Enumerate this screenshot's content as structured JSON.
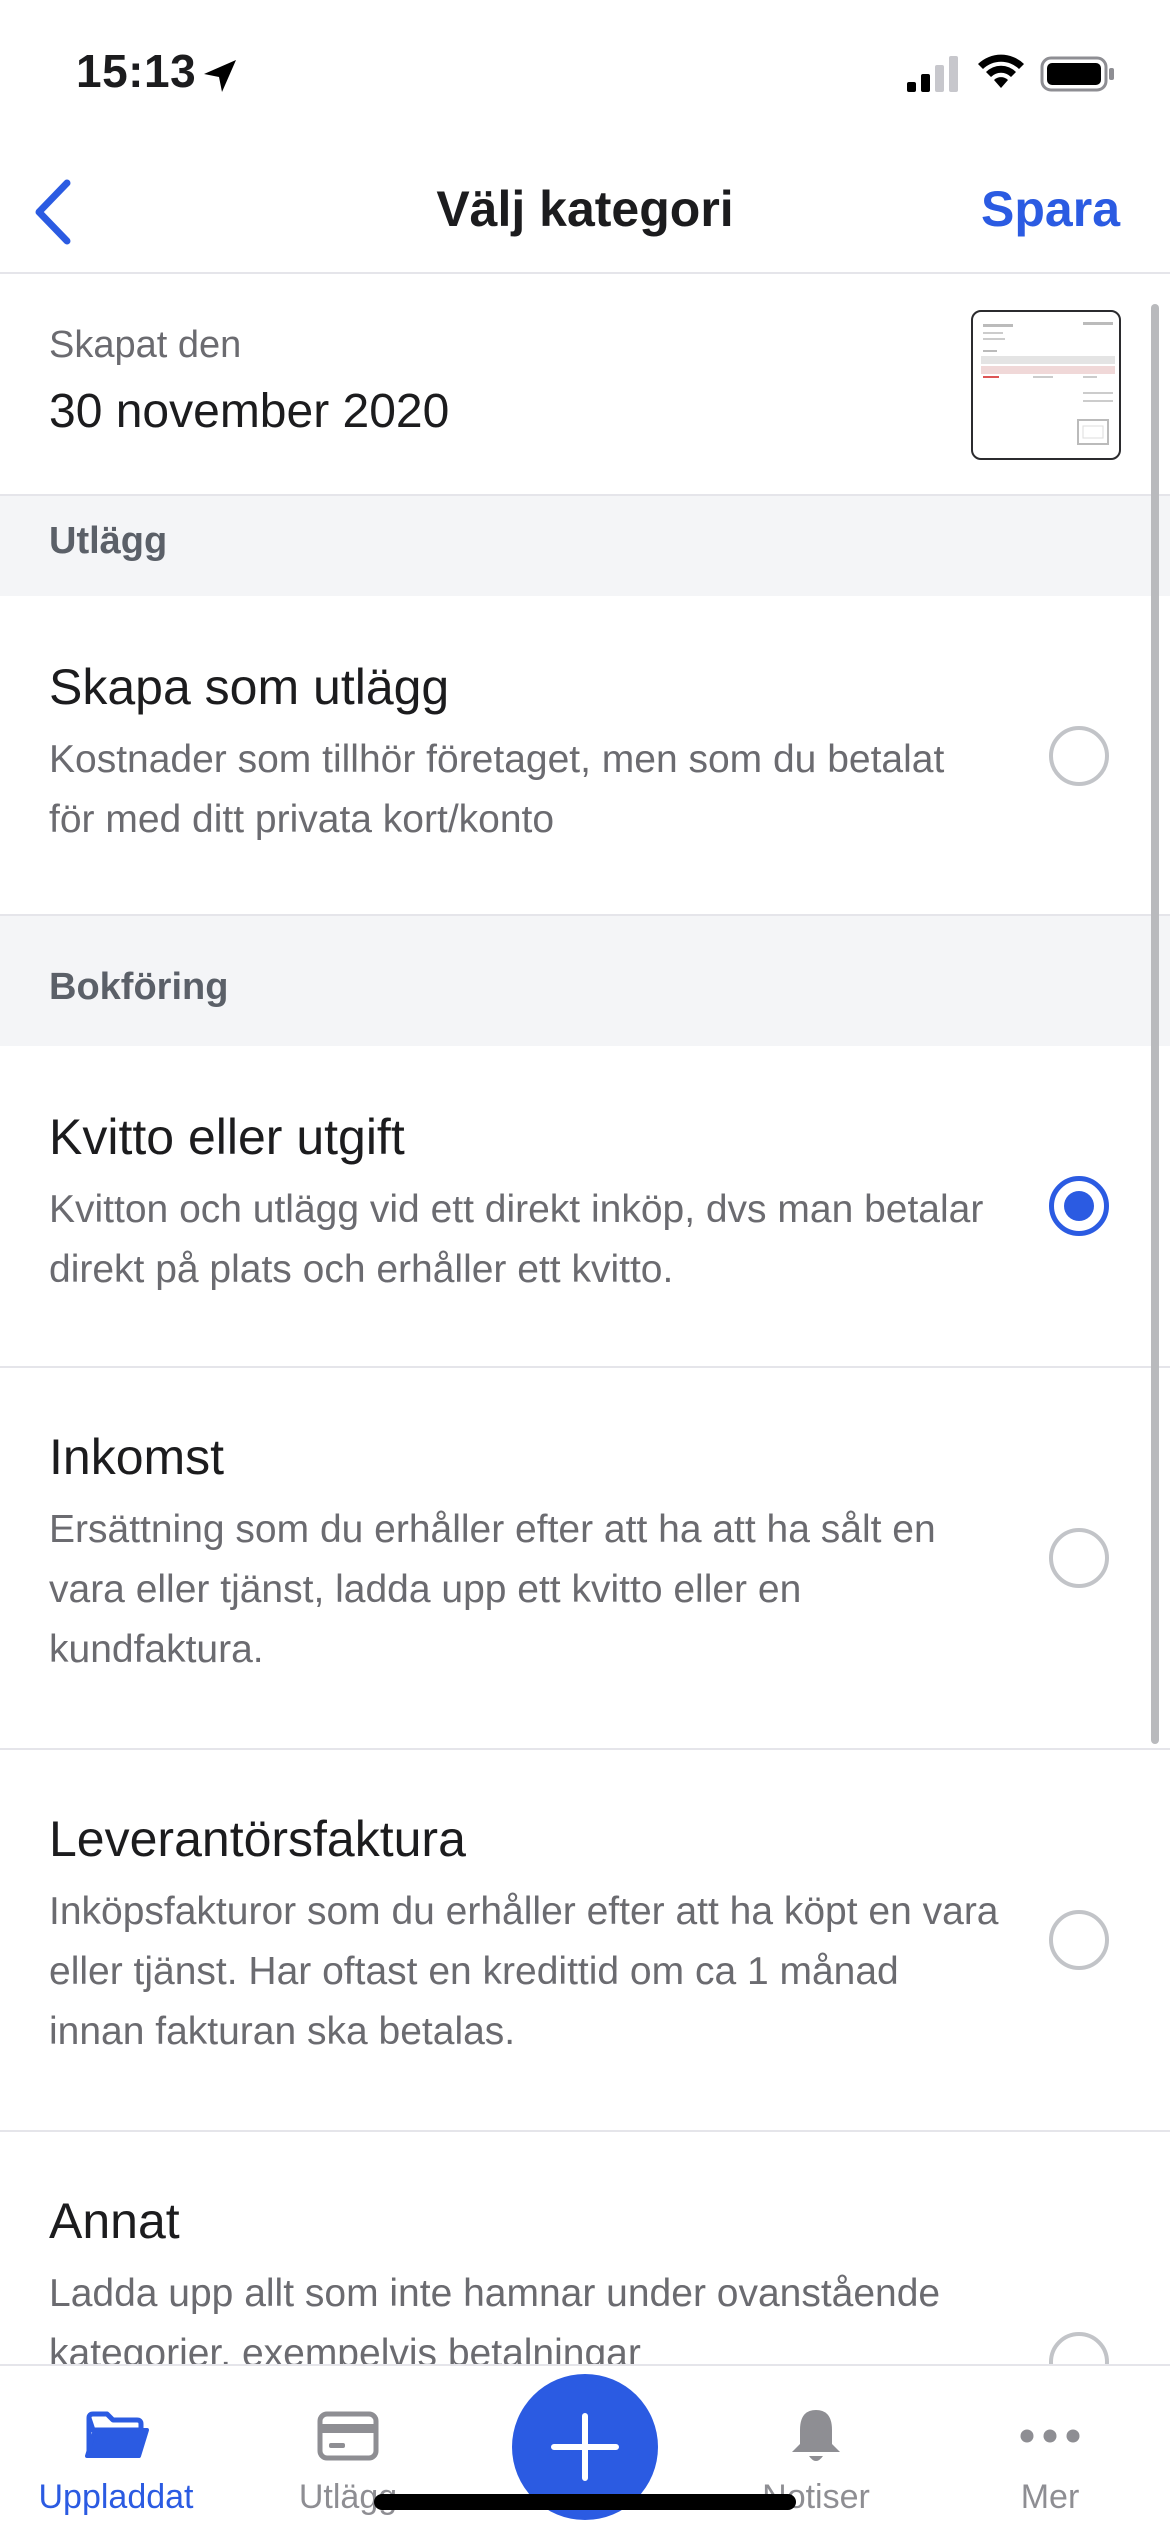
{
  "status_bar": {
    "time": "15:13"
  },
  "nav": {
    "back_icon": "chevron-left-icon",
    "title": "Välj kategori",
    "save_label": "Spara"
  },
  "created": {
    "label": "Skapat den",
    "date": "30 november 2020"
  },
  "sections": {
    "expenses": {
      "header": "Utlägg"
    },
    "bookkeeping": {
      "header": "Bokföring"
    }
  },
  "options": [
    {
      "title": "Skapa som utlägg",
      "description": "Kostnader som tillhör företaget, men som du betalat för med ditt privata kort/konto",
      "selected": false
    },
    {
      "title": "Kvitto eller utgift",
      "description": "Kvitton och utlägg vid ett direkt inköp, dvs man betalar direkt på plats och erhåller ett kvitto.",
      "selected": true
    },
    {
      "title": "Inkomst",
      "description": "Ersättning som du erhåller efter att ha att ha sålt en vara eller tjänst, ladda upp ett kvitto eller en kundfaktura.",
      "selected": false
    },
    {
      "title": "Leverantörsfaktura",
      "description": "Inköpsfakturor som du erhåller efter att ha köpt en vara eller tjänst. Har oftast en kredittid om ca 1 månad innan fakturan ska betalas.",
      "selected": false
    },
    {
      "title": "Annat",
      "description": "Ladda upp allt som inte hamnar under ovanstående kategorier, exempelvis betalningar",
      "selected": false
    }
  ],
  "tabs": [
    {
      "label": "Uppladdat",
      "icon": "folder-icon",
      "active": true
    },
    {
      "label": "Utlägg",
      "icon": "card-icon",
      "active": false
    },
    {
      "label": "Notiser",
      "icon": "bell-icon",
      "active": false
    },
    {
      "label": "Mer",
      "icon": "more-icon",
      "active": false
    }
  ],
  "add_button": {
    "icon": "plus-icon"
  },
  "colors": {
    "accent": "#2b5be2",
    "section_bg": "#f4f5f7",
    "secondary_text": "#6b6b70"
  }
}
